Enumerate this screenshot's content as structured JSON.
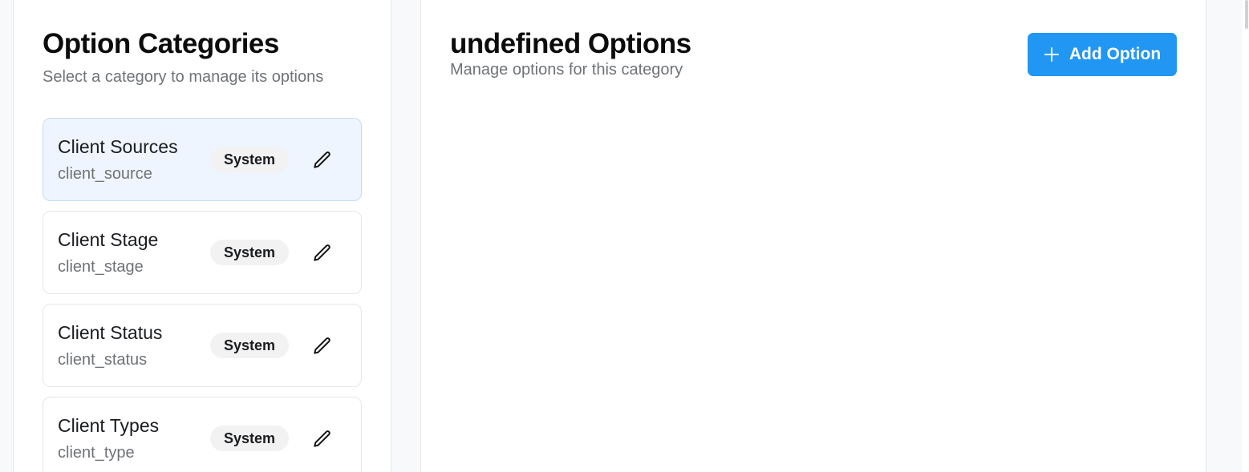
{
  "categories_panel": {
    "title": "Option Categories",
    "subtitle": "Select a category to manage its options",
    "items": [
      {
        "name": "Client Sources",
        "key": "client_source",
        "badge": "System",
        "selected": true
      },
      {
        "name": "Client Stage",
        "key": "client_stage",
        "badge": "System",
        "selected": false
      },
      {
        "name": "Client Status",
        "key": "client_status",
        "badge": "System",
        "selected": false
      },
      {
        "name": "Client Types",
        "key": "client_type",
        "badge": "System",
        "selected": false
      }
    ]
  },
  "options_panel": {
    "title": "undefined Options",
    "subtitle": "Manage options for this category",
    "add_button_label": "Add Option",
    "add_button_icon": "plus-icon"
  },
  "colors": {
    "accent": "#2196f3",
    "selected_card_bg": "#eef5fe",
    "badge_bg": "#f2f2f3"
  },
  "icons": {
    "edit": "pencil-icon"
  }
}
